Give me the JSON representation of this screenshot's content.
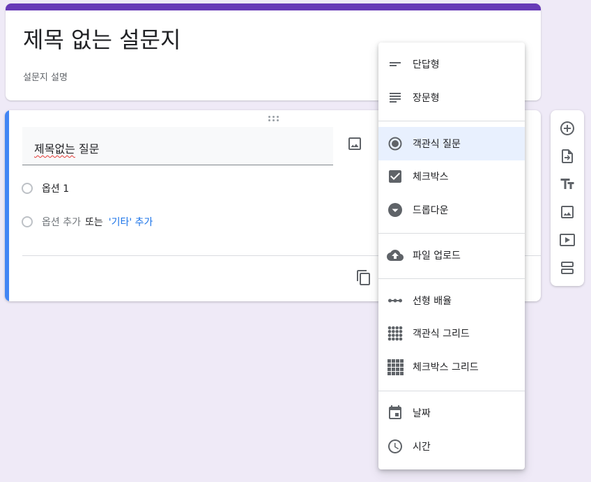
{
  "form": {
    "title": "제목 없는 설문지",
    "description": "설문지 설명",
    "accent_color": "#673ab7"
  },
  "question": {
    "title_prefix": "제목없는",
    "title_suffix": " 질문",
    "options": [
      {
        "label": "옵션 1"
      }
    ],
    "add_option_label": "옵션 추가",
    "or_label": "또는",
    "add_other_label": "'기타' 추가",
    "accent_color": "#4285f4"
  },
  "side_toolbar": {
    "icons": [
      "add-circle-icon",
      "import-questions-icon",
      "add-title-icon",
      "add-image-icon",
      "add-video-icon",
      "add-section-icon"
    ]
  },
  "type_menu": {
    "items": [
      {
        "label": "단답형",
        "icon": "short-answer-icon"
      },
      {
        "label": "장문형",
        "icon": "paragraph-icon"
      },
      {
        "label": "객관식 질문",
        "icon": "multiple-choice-icon",
        "selected": true
      },
      {
        "label": "체크박스",
        "icon": "checkbox-icon"
      },
      {
        "label": "드롭다운",
        "icon": "dropdown-icon"
      },
      {
        "label": "파일 업로드",
        "icon": "cloud-upload-icon"
      },
      {
        "label": "선형 배율",
        "icon": "linear-scale-icon"
      },
      {
        "label": "객관식 그리드",
        "icon": "multiple-choice-grid-icon"
      },
      {
        "label": "체크박스 그리드",
        "icon": "checkbox-grid-icon"
      },
      {
        "label": "날짜",
        "icon": "calendar-icon"
      },
      {
        "label": "시간",
        "icon": "clock-icon"
      }
    ]
  }
}
